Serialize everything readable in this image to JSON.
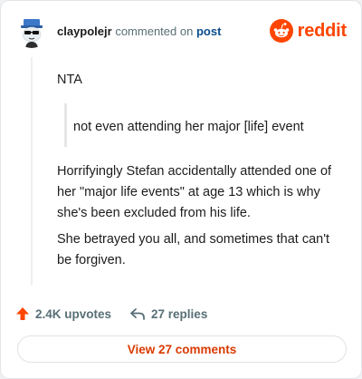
{
  "header": {
    "username": "claypolejr",
    "action_text": "commented on",
    "post_link": "post",
    "brand_name": "reddit"
  },
  "comment": {
    "paragraph_1": "NTA",
    "quote": "not even attending her major [life] event",
    "paragraph_2": "Horrifyingly Stefan accidentally attended one of her \"major life events\" at age 13 which is why she's been excluded from his life.",
    "paragraph_3": "She betrayed you all, and sometimes that can't be forgiven."
  },
  "actions": {
    "upvotes_label": "2.4K upvotes",
    "replies_label": "27 replies"
  },
  "footer": {
    "view_comments_label": "View 27 comments"
  },
  "colors": {
    "brand": "#ff4500",
    "upvote": "#ff4500",
    "link": "#0a4d8c",
    "view_button_text": "#d93a00"
  },
  "icons": {
    "avatar": "snoo-avatar-with-hat-and-sunglasses",
    "brand": "reddit-snoo-logo-icon",
    "upvote": "upvote-arrow-icon",
    "reply": "reply-arrow-icon"
  }
}
